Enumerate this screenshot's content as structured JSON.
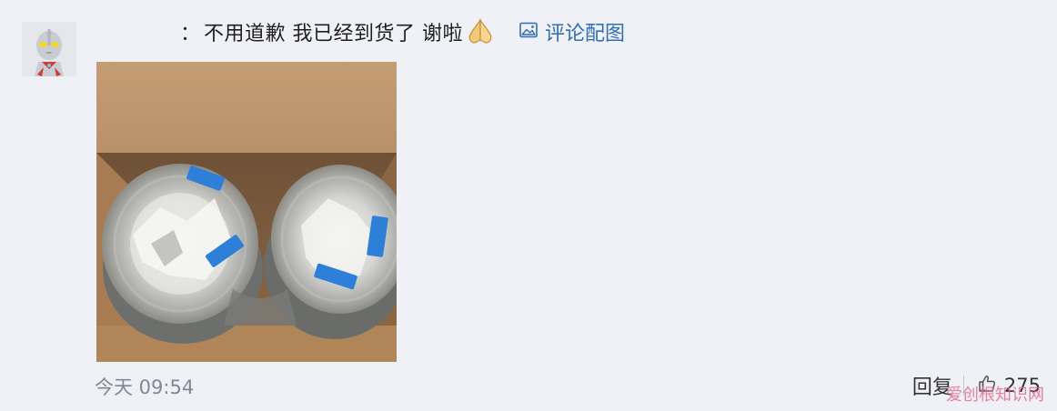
{
  "comment": {
    "prefix": "：",
    "text": "不用道歉 我已经到货了 谢啦",
    "emoji_icon": "pray-hands-icon",
    "pic_link_icon": "image-icon",
    "pic_link_label": "评论配图"
  },
  "photo": {
    "subject": "cups-in-box-photo"
  },
  "footer": {
    "timestamp": "今天 09:54",
    "reply_label": "回复",
    "like_icon": "thumbs-up-icon",
    "like_count": "275"
  },
  "watermark": {
    "text": "爱创根知识网"
  },
  "colors": {
    "background": "#eff1f6",
    "link": "#2f6fb3",
    "timestamp": "#808894",
    "tape": "#2e7fd8"
  }
}
